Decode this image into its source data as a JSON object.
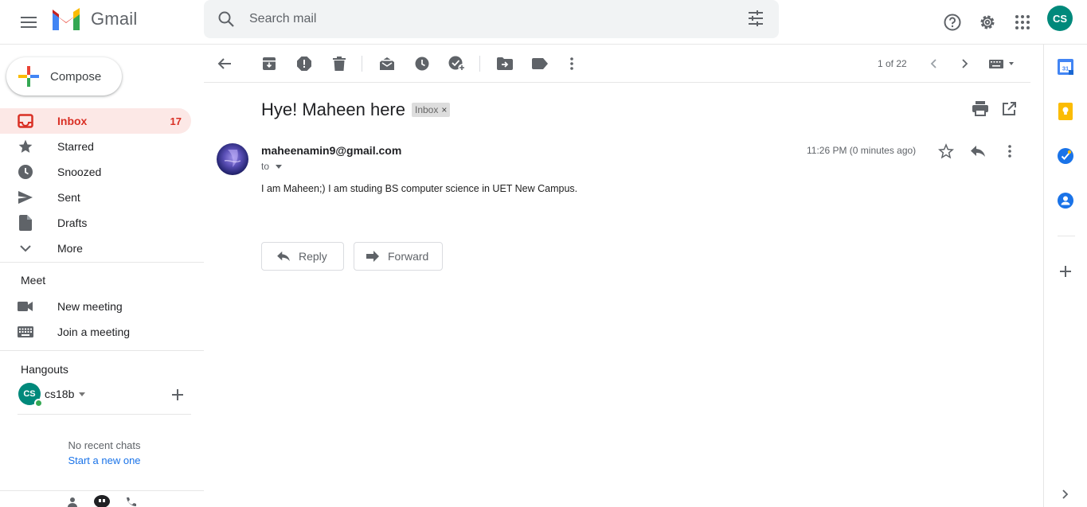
{
  "app": {
    "name": "Gmail"
  },
  "search": {
    "placeholder": "Search mail"
  },
  "account": {
    "initials": "CS"
  },
  "compose": {
    "label": "Compose"
  },
  "nav": {
    "items": [
      {
        "label": "Inbox",
        "count": "17",
        "icon": "inbox-icon"
      },
      {
        "label": "Starred",
        "icon": "star-icon"
      },
      {
        "label": "Snoozed",
        "icon": "clock-icon"
      },
      {
        "label": "Sent",
        "icon": "send-icon"
      },
      {
        "label": "Drafts",
        "icon": "draft-icon"
      },
      {
        "label": "More",
        "icon": "chevron-down-icon"
      }
    ]
  },
  "meet": {
    "title": "Meet",
    "new_meeting": "New meeting",
    "join_meeting": "Join a meeting"
  },
  "hangouts": {
    "title": "Hangouts",
    "user_initials": "CS",
    "user_name": "cs18b",
    "no_chats": "No recent chats",
    "start_new": "Start a new one"
  },
  "toolbar": {
    "pager": "1 of 22"
  },
  "email": {
    "subject": "Hye! Maheen here",
    "label_chip": "Inbox",
    "chip_close": "×",
    "sender": "maheenamin9@gmail.com",
    "to": "to",
    "timestamp": "11:26 PM (0 minutes ago)",
    "body": "I am Maheen;) I am studing BS computer science in UET New Campus."
  },
  "actions": {
    "reply": "Reply",
    "forward": "Forward"
  },
  "rail": {
    "calendar_day": "31"
  },
  "colors": {
    "accent_red": "#d93025",
    "active_bg": "#fce8e6",
    "avatar_teal": "#00897b",
    "link_blue": "#1a73e8"
  }
}
